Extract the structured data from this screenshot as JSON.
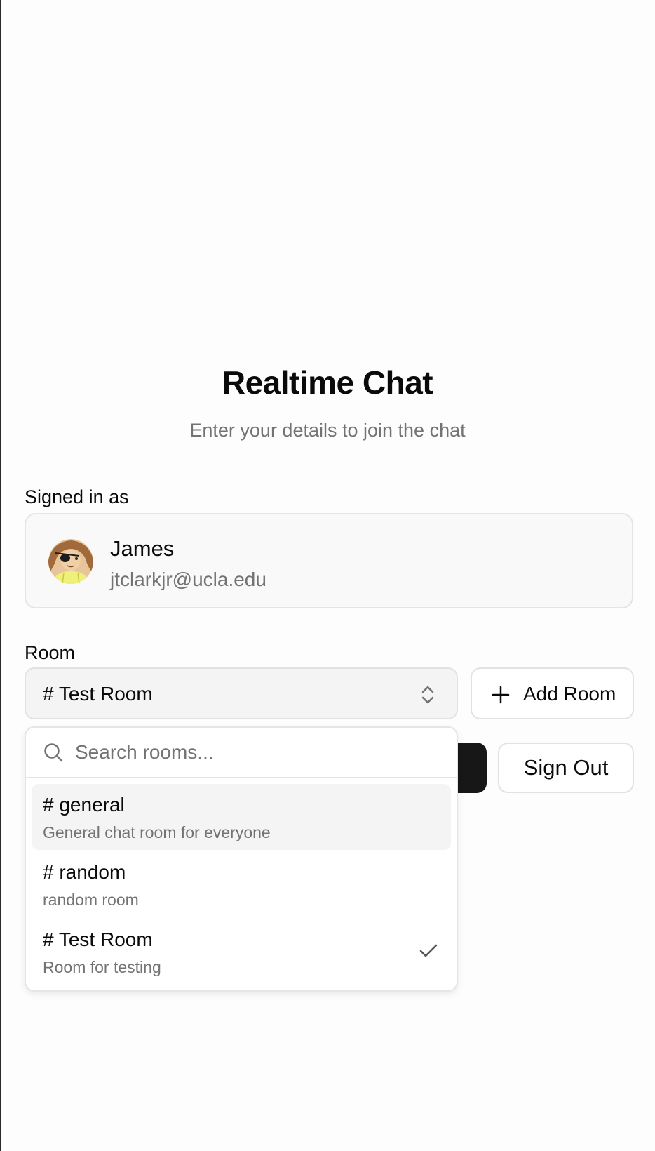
{
  "header": {
    "title": "Realtime Chat",
    "subtitle": "Enter your details to join the chat"
  },
  "user": {
    "section_label": "Signed in as",
    "name": "James",
    "email": "jtclarkjr@ucla.edu",
    "avatar_icon": "avatar-image"
  },
  "room": {
    "section_label": "Room",
    "selected": "# Test Room",
    "add_label": "Add Room"
  },
  "actions": {
    "sign_out_label": "Sign Out"
  },
  "dropdown": {
    "search_placeholder": "Search rooms...",
    "options": [
      {
        "name": "# general",
        "description": "General chat room for everyone",
        "highlighted": true,
        "selected": false
      },
      {
        "name": "# random",
        "description": "random room",
        "highlighted": false,
        "selected": false
      },
      {
        "name": "# Test Room",
        "description": "Room for testing",
        "highlighted": false,
        "selected": true
      }
    ]
  },
  "colors": {
    "primary_button": "#171717",
    "muted_text": "#737373",
    "border": "#e5e5e5",
    "highlight": "#f4f4f4"
  }
}
